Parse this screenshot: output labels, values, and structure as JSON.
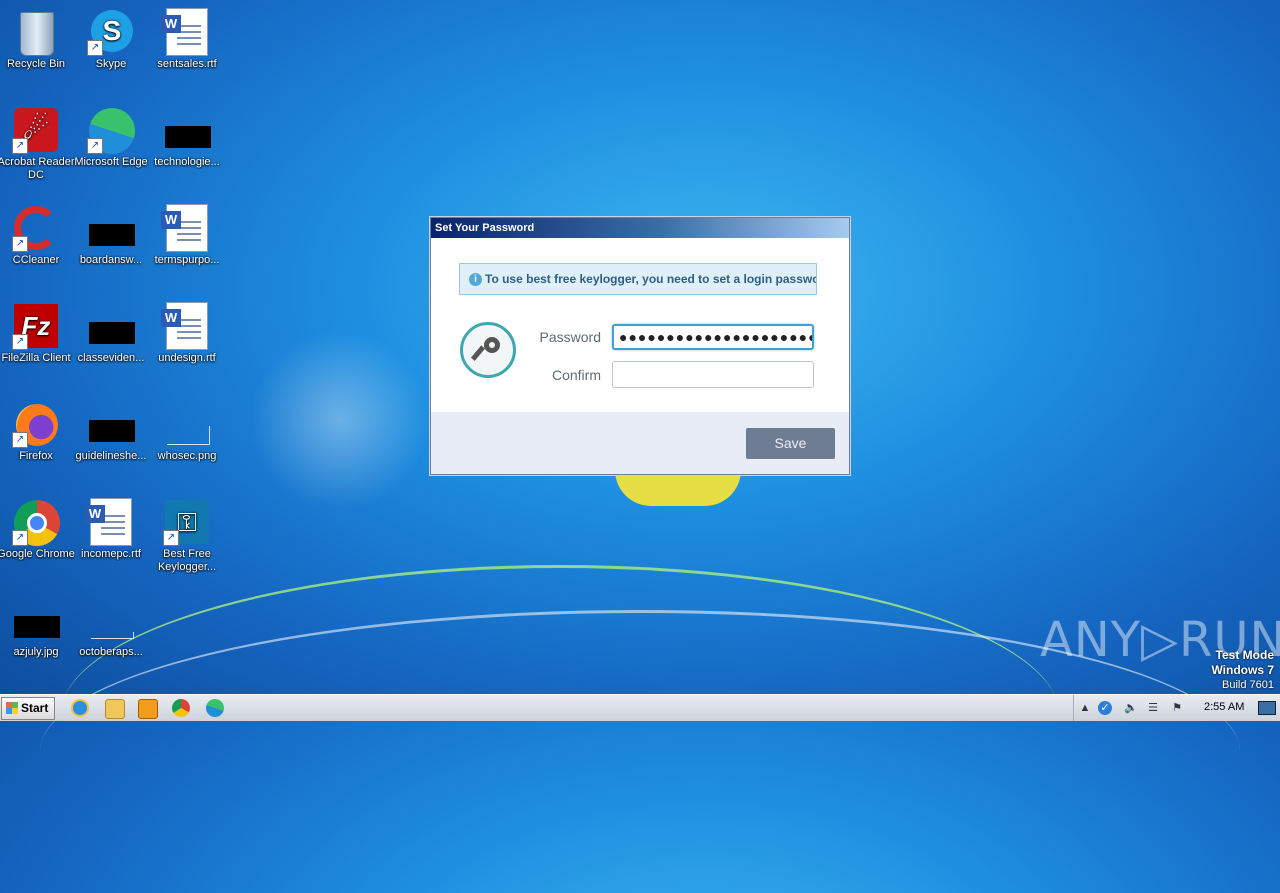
{
  "desktop": {
    "icons": [
      {
        "label": "Recycle Bin"
      },
      {
        "label": "Skype"
      },
      {
        "label": "sentsales.rtf"
      },
      {
        "label": "Acrobat Reader DC"
      },
      {
        "label": "Microsoft Edge"
      },
      {
        "label": "technologie..."
      },
      {
        "label": "CCleaner"
      },
      {
        "label": "boardansw..."
      },
      {
        "label": "termspurpo..."
      },
      {
        "label": "FileZilla Client"
      },
      {
        "label": "classeviden..."
      },
      {
        "label": "undesign.rtf"
      },
      {
        "label": "Firefox"
      },
      {
        "label": "guidelineshe..."
      },
      {
        "label": "whosec.png"
      },
      {
        "label": "Google Chrome"
      },
      {
        "label": "incomepc.rtf"
      },
      {
        "label": "Best Free Keylogger..."
      },
      {
        "label": "azjuly.jpg"
      },
      {
        "label": "octoberaps..."
      }
    ]
  },
  "dialog": {
    "title": "Set Your Password",
    "info_text": "To use best free keylogger, you need to set a login password.",
    "password_label": "Password",
    "password_value": "●●●●●●●●●●●●●●●●●●●●●●●",
    "confirm_label": "Confirm",
    "confirm_value": "",
    "save_label": "Save"
  },
  "watermark": {
    "brand": "ANY▷RUN",
    "line1": "Test Mode",
    "line2": "Windows 7",
    "line3": "Build 7601"
  },
  "taskbar": {
    "start_label": "Start",
    "pinned": [
      "internet-explorer-icon",
      "file-explorer-icon",
      "media-player-icon",
      "chrome-icon",
      "edge-icon"
    ],
    "clock": "2:55 AM"
  }
}
